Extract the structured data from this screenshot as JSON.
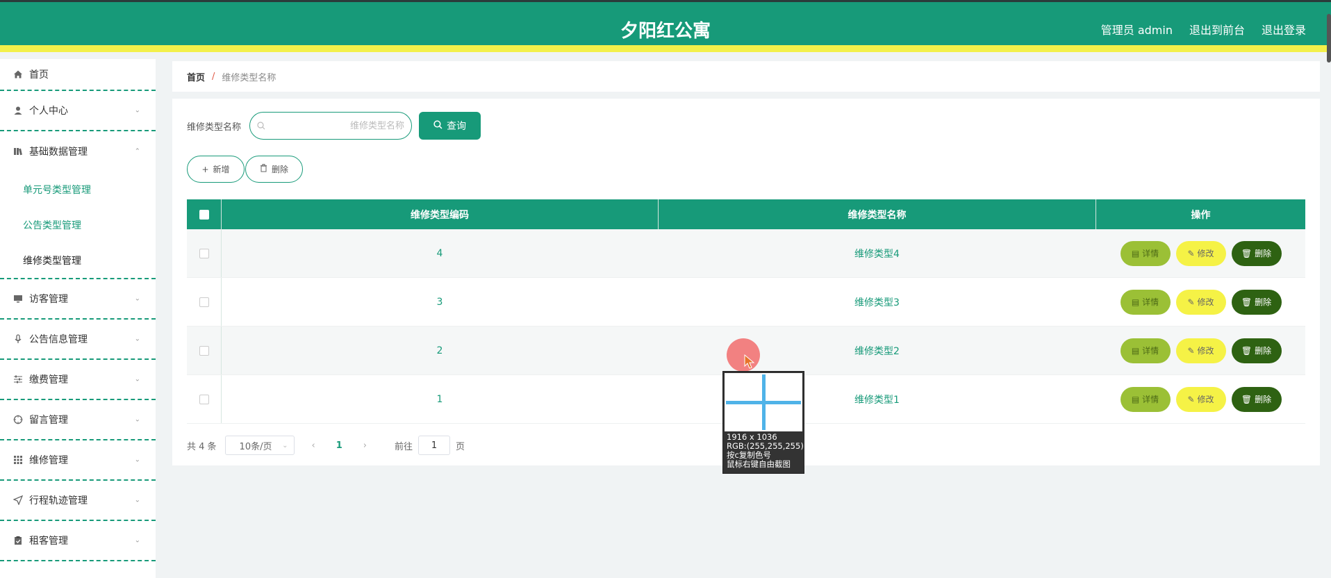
{
  "header": {
    "title": "夕阳红公寓",
    "admin_label": "管理员 admin",
    "front_label": "退出到前台",
    "logout_label": "退出登录"
  },
  "sidebar": {
    "home": "首页",
    "personal": "个人中心",
    "basic": "基础数据管理",
    "sub_unit": "单元号类型管理",
    "sub_notice": "公告类型管理",
    "sub_repair": "维修类型管理",
    "visitor": "访客管理",
    "notice_info": "公告信息管理",
    "payment": "缴费管理",
    "message": "留言管理",
    "repair": "维修管理",
    "trip": "行程轨迹管理",
    "rent": "租客管理"
  },
  "breadcrumb": {
    "home": "首页",
    "sep": "/",
    "current": "维修类型名称"
  },
  "search": {
    "label": "维修类型名称",
    "placeholder": "维修类型名称",
    "button": "查询"
  },
  "actions": {
    "add": "新增",
    "delete": "删除"
  },
  "table": {
    "headers": [
      "维修类型编码",
      "维修类型名称",
      "操作"
    ],
    "rows": [
      {
        "code": "4",
        "name": "维修类型4"
      },
      {
        "code": "3",
        "name": "维修类型3"
      },
      {
        "code": "2",
        "name": "维修类型2"
      },
      {
        "code": "1",
        "name": "维修类型1"
      }
    ],
    "op_detail": "详情",
    "op_edit": "修改",
    "op_delete": "删除"
  },
  "pagination": {
    "total": "共 4 条",
    "page_size": "10条/页",
    "current": "1",
    "goto_label": "前往",
    "goto_value": "1",
    "page_suffix": "页"
  },
  "overlay": {
    "magnifier_text": "1916 x 1036\nRGB:(255,255,255)\n按c复制色号\n鼠标右键自由截图"
  },
  "colors": {
    "primary": "#179a79",
    "accent_yellow": "#f3f04a",
    "detail": "#9bc036",
    "edit": "#f5f246",
    "delete": "#2e6212"
  }
}
